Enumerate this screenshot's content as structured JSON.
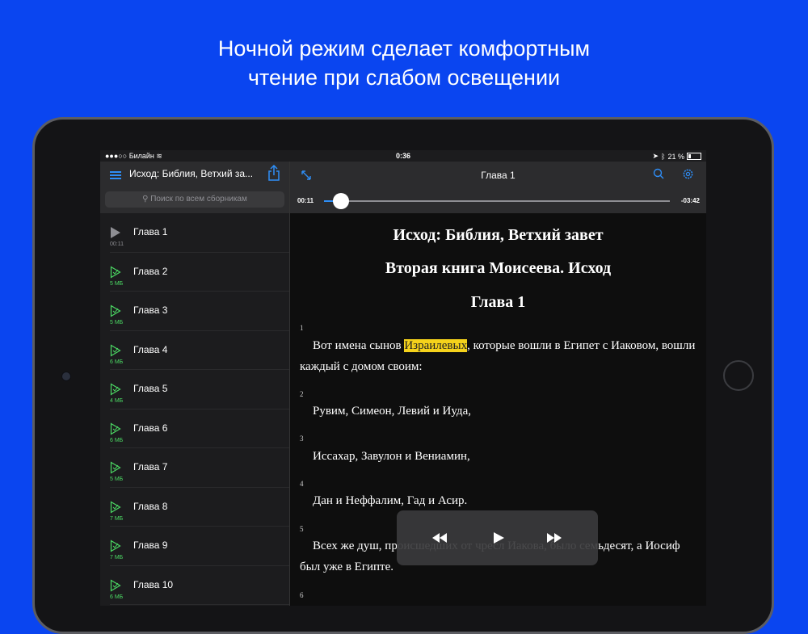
{
  "headline": {
    "line1": "Ночной режим сделает комфортным",
    "line2": "чтение при слабом освещении"
  },
  "status_bar": {
    "carrier": "Билайн",
    "time": "0:36",
    "battery": "21 %"
  },
  "sidebar": {
    "title": "Исход: Библия, Ветхий за...",
    "search_placeholder": "Поиск по всем сборникам",
    "chapters": [
      {
        "label": "Глава 1",
        "size": "00:11",
        "state": "playing"
      },
      {
        "label": "Глава 2",
        "size": "5 МБ",
        "state": "downloaded"
      },
      {
        "label": "Глава 3",
        "size": "5 МБ",
        "state": "downloaded"
      },
      {
        "label": "Глава 4",
        "size": "6 МБ",
        "state": "downloaded"
      },
      {
        "label": "Глава 5",
        "size": "4 МБ",
        "state": "downloaded"
      },
      {
        "label": "Глава 6",
        "size": "6 МБ",
        "state": "downloaded"
      },
      {
        "label": "Глава 7",
        "size": "5 МБ",
        "state": "downloaded"
      },
      {
        "label": "Глава 8",
        "size": "7 МБ",
        "state": "downloaded"
      },
      {
        "label": "Глава 9",
        "size": "7 МБ",
        "state": "downloaded"
      },
      {
        "label": "Глава 10",
        "size": "6 МБ",
        "state": "downloaded"
      }
    ]
  },
  "toolbar": {
    "title": "Глава 1",
    "time_elapsed": "00:11",
    "time_remaining": "-03:42",
    "progress": 0.05
  },
  "content": {
    "heading1": "Исход: Библия, Ветхий завет",
    "heading2": "Вторая книга Моисеева. Исход",
    "heading3": "Глава 1",
    "verses": [
      {
        "num": "1",
        "before": "Вот имена сынов ",
        "highlight": "Израилевых",
        "after": ", которые вошли в Египет с Иаковом, вошли каждый с домом своим:"
      },
      {
        "num": "2",
        "text": "Рувим, Симеон, Левий и Иуда,"
      },
      {
        "num": "3",
        "text": "Иссахар, Завулон и Вениамин,"
      },
      {
        "num": "4",
        "text": "Дан и Неффалим, Гад и Асир."
      },
      {
        "num": "5",
        "text": "Всех же душ, происшедших от чресл Иакова, было семьдесят, а Иосиф был уже в Египте."
      },
      {
        "num": "6"
      }
    ]
  },
  "colors": {
    "background": "#0a45f0",
    "accent": "#2e8ef7",
    "downloaded": "#4cd964",
    "highlight": "#f5d21b"
  }
}
